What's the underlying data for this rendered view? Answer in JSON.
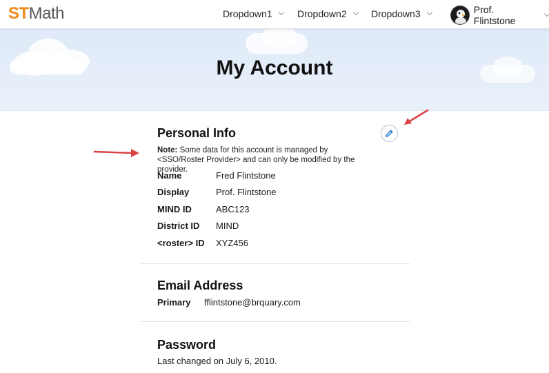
{
  "brand": {
    "logo_st": "ST",
    "logo_math": "Math"
  },
  "nav": {
    "dropdowns": [
      {
        "label": "Dropdown1"
      },
      {
        "label": "Dropdown2"
      },
      {
        "label": "Dropdown3"
      }
    ],
    "user_name": "Prof. Flintstone"
  },
  "hero": {
    "title": "My Account"
  },
  "personal_info": {
    "title": "Personal Info",
    "note_label": "Note:",
    "note_text": " Some data for this account is managed by <SSO/Roster Provider> and can only be modified by the provider.",
    "fields": [
      {
        "label": "Name",
        "value": "Fred Flintstone"
      },
      {
        "label": "Display",
        "value": "Prof. Flintstone"
      },
      {
        "label": "MIND ID",
        "value": "ABC123"
      },
      {
        "label": "District ID",
        "value": "MIND"
      },
      {
        "label": "<roster> ID",
        "value": "XYZ456"
      }
    ]
  },
  "email": {
    "title": "Email Address",
    "primary_label": "Primary",
    "primary_value": "fflintstone@brquary.com"
  },
  "password": {
    "title": "Password",
    "last_changed": "Last changed on July 6, 2010."
  },
  "colors": {
    "brand_orange": "#f08a1c",
    "edit_blue": "#2f7fd6",
    "annotation_red": "#d94343"
  }
}
